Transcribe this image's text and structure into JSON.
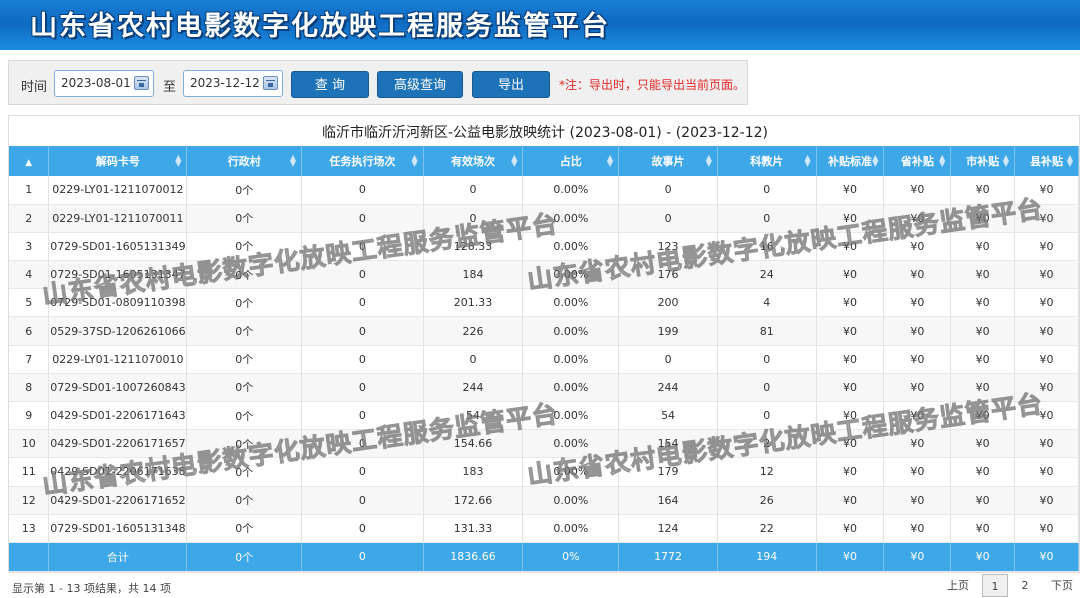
{
  "app": {
    "title": "山东省农村电影数字化放映工程服务监管平台"
  },
  "toolbar": {
    "time_label": "时间",
    "start_date": "2023-08-01",
    "to_label": "至",
    "end_date": "2023-12-12",
    "query_label": "查 询",
    "advanced_label": "高级查询",
    "export_label": "导出",
    "note": "*注：导出时，只能导出当前页面。"
  },
  "table": {
    "caption": "临沂市临沂沂河新区-公益电影放映统计  (2023-08-01) - (2023-12-12)",
    "headers": [
      "解码卡号",
      "行政村",
      "任务执行场次",
      "有效场次",
      "占比",
      "故事片",
      "科教片",
      "补贴标准",
      "省补贴",
      "市补贴",
      "县补贴"
    ],
    "rows": [
      [
        "1",
        "0229-LY01-1211070012",
        "0个",
        "0",
        "0",
        "0.00%",
        "0",
        "0",
        "¥0",
        "¥0",
        "¥0",
        "¥0"
      ],
      [
        "2",
        "0229-LY01-1211070011",
        "0个",
        "0",
        "0",
        "0.00%",
        "0",
        "0",
        "¥0",
        "¥0",
        "¥0",
        "¥0"
      ],
      [
        "3",
        "0729-SD01-1605131349",
        "0个",
        "0",
        "128.33",
        "0.00%",
        "123",
        "16",
        "¥0",
        "¥0",
        "¥0",
        "¥0"
      ],
      [
        "4",
        "0729-SD01-1605131347",
        "0个",
        "0",
        "184",
        "0.00%",
        "176",
        "24",
        "¥0",
        "¥0",
        "¥0",
        "¥0"
      ],
      [
        "5",
        "0729-SD01-0809110398",
        "0个",
        "0",
        "201.33",
        "0.00%",
        "200",
        "4",
        "¥0",
        "¥0",
        "¥0",
        "¥0"
      ],
      [
        "6",
        "0529-37SD-1206261066",
        "0个",
        "0",
        "226",
        "0.00%",
        "199",
        "81",
        "¥0",
        "¥0",
        "¥0",
        "¥0"
      ],
      [
        "7",
        "0229-LY01-1211070010",
        "0个",
        "0",
        "0",
        "0.00%",
        "0",
        "0",
        "¥0",
        "¥0",
        "¥0",
        "¥0"
      ],
      [
        "8",
        "0729-SD01-1007260843",
        "0个",
        "0",
        "244",
        "0.00%",
        "244",
        "0",
        "¥0",
        "¥0",
        "¥0",
        "¥0"
      ],
      [
        "9",
        "0429-SD01-2206171643",
        "0个",
        "0",
        "54",
        "0.00%",
        "54",
        "0",
        "¥0",
        "¥0",
        "¥0",
        "¥0"
      ],
      [
        "10",
        "0429-SD01-2206171657",
        "0个",
        "0",
        "154.66",
        "0.00%",
        "154",
        "2",
        "¥0",
        "¥0",
        "¥0",
        "¥0"
      ],
      [
        "11",
        "0429-SD01-2206171638",
        "0个",
        "0",
        "183",
        "0.00%",
        "179",
        "12",
        "¥0",
        "¥0",
        "¥0",
        "¥0"
      ],
      [
        "12",
        "0429-SD01-2206171652",
        "0个",
        "0",
        "172.66",
        "0.00%",
        "164",
        "26",
        "¥0",
        "¥0",
        "¥0",
        "¥0"
      ],
      [
        "13",
        "0729-SD01-1605131348",
        "0个",
        "0",
        "131.33",
        "0.00%",
        "124",
        "22",
        "¥0",
        "¥0",
        "¥0",
        "¥0"
      ]
    ],
    "totals": [
      "",
      "合计",
      "0个",
      "0",
      "1836.66",
      "0%",
      "1772",
      "194",
      "¥0",
      "¥0",
      "¥0",
      "¥0"
    ]
  },
  "footer": {
    "summary": "显示第 1 - 13 项结果，共 14 项",
    "prev_label": "上页",
    "page1": "1",
    "page2": "2",
    "next_label": "下页"
  },
  "watermark": "山东省农村电影数字化放映工程服务监管平台"
}
